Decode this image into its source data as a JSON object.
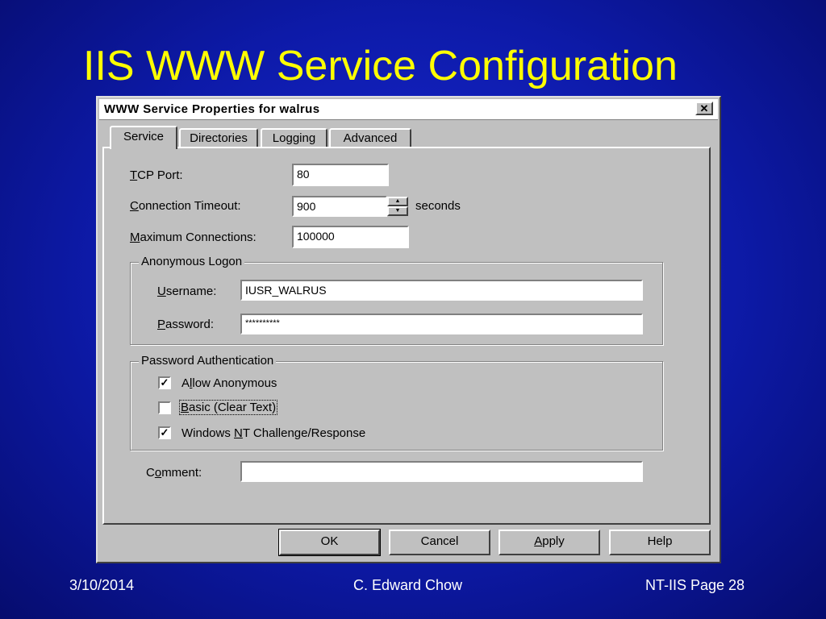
{
  "slide": {
    "title": "IIS WWW Service Configuration",
    "footer_left": "3/10/2014",
    "footer_center": "C. Edward Chow",
    "footer_right": "NT-IIS Page 28"
  },
  "dialog": {
    "title": "WWW Service Properties for walrus",
    "close_glyph": "✕",
    "tabs": [
      {
        "label": "Service"
      },
      {
        "label": "Directories"
      },
      {
        "label": "Logging"
      },
      {
        "label": "Advanced"
      }
    ],
    "tcp_port": {
      "label_accel": "T",
      "label_rest": "CP Port:",
      "value": "80"
    },
    "connection_timeout": {
      "label_accel": "C",
      "label_rest": "onnection Timeout:",
      "value": "900",
      "unit": "seconds"
    },
    "max_connections": {
      "label_accel": "M",
      "label_rest": "aximum Connections:",
      "value": "100000"
    },
    "anonymous_logon": {
      "legend": "Anonymous Logon",
      "username": {
        "label_accel": "U",
        "label_rest": "sername:",
        "value": "IUSR_WALRUS"
      },
      "password": {
        "label_accel": "P",
        "label_rest": "assword:",
        "value": "**********"
      }
    },
    "password_auth": {
      "legend": "Password Authentication",
      "allow_anonymous": {
        "label_pre": "A",
        "label_accel": "l",
        "label_rest": "low Anonymous",
        "checked": true,
        "mark": "✓"
      },
      "basic": {
        "label_accel": "B",
        "label_rest": "asic (Clear Text)",
        "checked": false,
        "mark": ""
      },
      "windows_nt": {
        "label_pre": "Windows ",
        "label_accel": "N",
        "label_rest": "T Challenge/Response",
        "checked": true,
        "mark": "✓"
      }
    },
    "comment": {
      "label_pre": "C",
      "label_accel": "o",
      "label_rest": "mment:",
      "value": ""
    },
    "buttons": {
      "ok": "OK",
      "cancel": "Cancel",
      "apply_accel": "A",
      "apply_rest": "pply",
      "help": "Help"
    },
    "colors": {
      "face": "#c0c0c0",
      "title_text": "#ffff00",
      "background": "#0d1aa8"
    }
  }
}
